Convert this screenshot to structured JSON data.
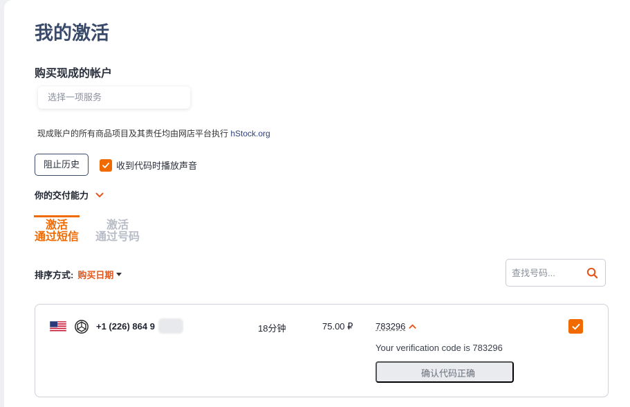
{
  "page": {
    "title": "我的激活",
    "section_title": "购买现成的帐户",
    "service_select_placeholder": "选择一项服务",
    "notice_text": "现成账户的所有商品项目及其责任均由网店平台执行 ",
    "notice_link": "hStock.org",
    "block_history_label": "阻止历史",
    "sound_label": "收到代码时播放声音",
    "sound_checked": true,
    "capacity_label": "你的交付能力"
  },
  "tabs": [
    {
      "line1": "激活",
      "line2": "通过短信",
      "active": true
    },
    {
      "line1": "激活",
      "line2": "通过号码",
      "active": false
    }
  ],
  "sort": {
    "label": "排序方式:",
    "value": "购买日期"
  },
  "search": {
    "placeholder": "查找号码..."
  },
  "activation": {
    "country_flag": "us-flag-icon",
    "service_icon": "openai-icon",
    "phone": "+1 (226) 864 9",
    "duration": "18分钟",
    "price": "75.00 ₽",
    "code": "783296",
    "message": "Your verification code is 783296",
    "confirm_label": "确认代码正确",
    "selected": true
  },
  "colors": {
    "accent": "#f06a00",
    "title": "#3a4a6b",
    "sort_value": "#e4561a"
  }
}
